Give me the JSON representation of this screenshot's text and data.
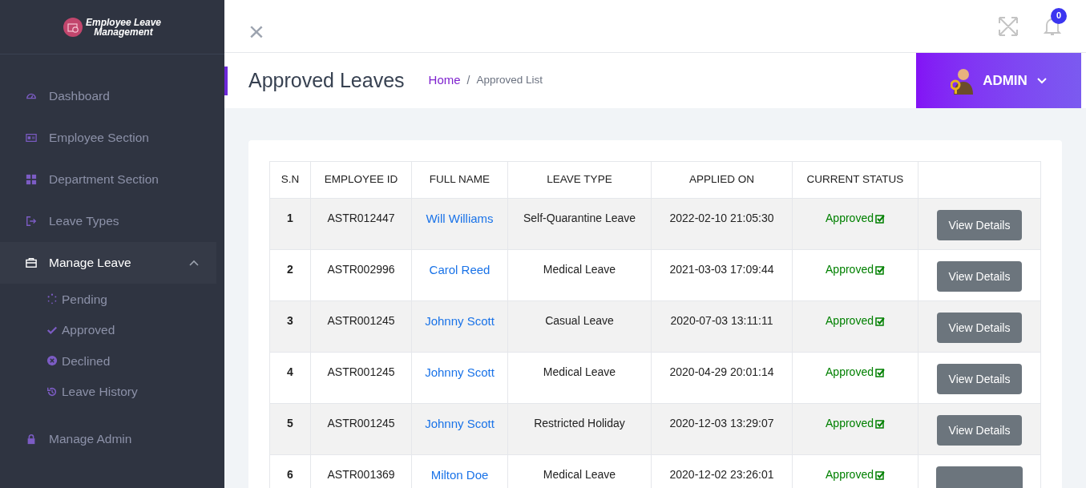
{
  "brand": {
    "line_1": "Employee Leave",
    "line_2": "Management"
  },
  "sidebar": {
    "items": [
      {
        "label": "Dashboard",
        "kind": "dashboard",
        "selected": false
      },
      {
        "label": "Employee Section",
        "kind": "employees",
        "selected": false
      },
      {
        "label": "Department Section",
        "kind": "departments",
        "selected": false
      },
      {
        "label": "Leave Types",
        "kind": "types",
        "selected": false
      },
      {
        "label": "Manage Leave",
        "kind": "leave",
        "selected": true,
        "expanded": true,
        "children": [
          {
            "label": "Pending",
            "kind": "pending"
          },
          {
            "label": "Approved",
            "kind": "approved"
          },
          {
            "label": "Declined",
            "kind": "declined"
          },
          {
            "label": "Leave History",
            "kind": "history"
          }
        ]
      },
      {
        "label": "Manage Admin",
        "kind": "admin",
        "selected": false
      }
    ]
  },
  "topbar": {
    "close": "×",
    "notification_count": "0"
  },
  "header": {
    "title": "Approved Leaves",
    "breadcrumb": [
      "Home",
      "Approved List"
    ],
    "breadcrumb_separator": "/",
    "user": "ADMIN"
  },
  "table": {
    "columns": [
      "S.N",
      "EMPLOYEE ID",
      "FULL NAME",
      "LEAVE TYPE",
      "APPLIED ON",
      "CURRENT STATUS"
    ],
    "rows": [
      {
        "sn": "1",
        "employee_id": "ASTR012447",
        "full_name": "Will Williams",
        "leave_type": "Self-Quarantine Leave",
        "applied_on": "2022-02-10 21:05:30",
        "status": "Approved",
        "action": "View Details"
      },
      {
        "sn": "2",
        "employee_id": "ASTR002996",
        "full_name": "Carol Reed",
        "leave_type": "Medical Leave",
        "applied_on": "2021-03-03 17:09:44",
        "status": "Approved",
        "action": "View Details"
      },
      {
        "sn": "3",
        "employee_id": "ASTR001245",
        "full_name": "Johnny Scott",
        "leave_type": "Casual Leave",
        "applied_on": "2020-07-03 13:11:11",
        "status": "Approved",
        "action": "View Details"
      },
      {
        "sn": "4",
        "employee_id": "ASTR001245",
        "full_name": "Johnny Scott",
        "leave_type": "Medical Leave",
        "applied_on": "2020-04-29 20:01:14",
        "status": "Approved",
        "action": "View Details"
      },
      {
        "sn": "5",
        "employee_id": "ASTR001245",
        "full_name": "Johnny Scott",
        "leave_type": "Restricted Holiday",
        "applied_on": "2020-12-03 13:29:07",
        "status": "Approved",
        "action": "View Details"
      },
      {
        "sn": "6",
        "employee_id": "ASTR001369",
        "full_name": "Milton Doe",
        "leave_type": "Medical Leave",
        "applied_on": "2020-12-02 23:26:01",
        "status": "Approved"
      }
    ]
  }
}
